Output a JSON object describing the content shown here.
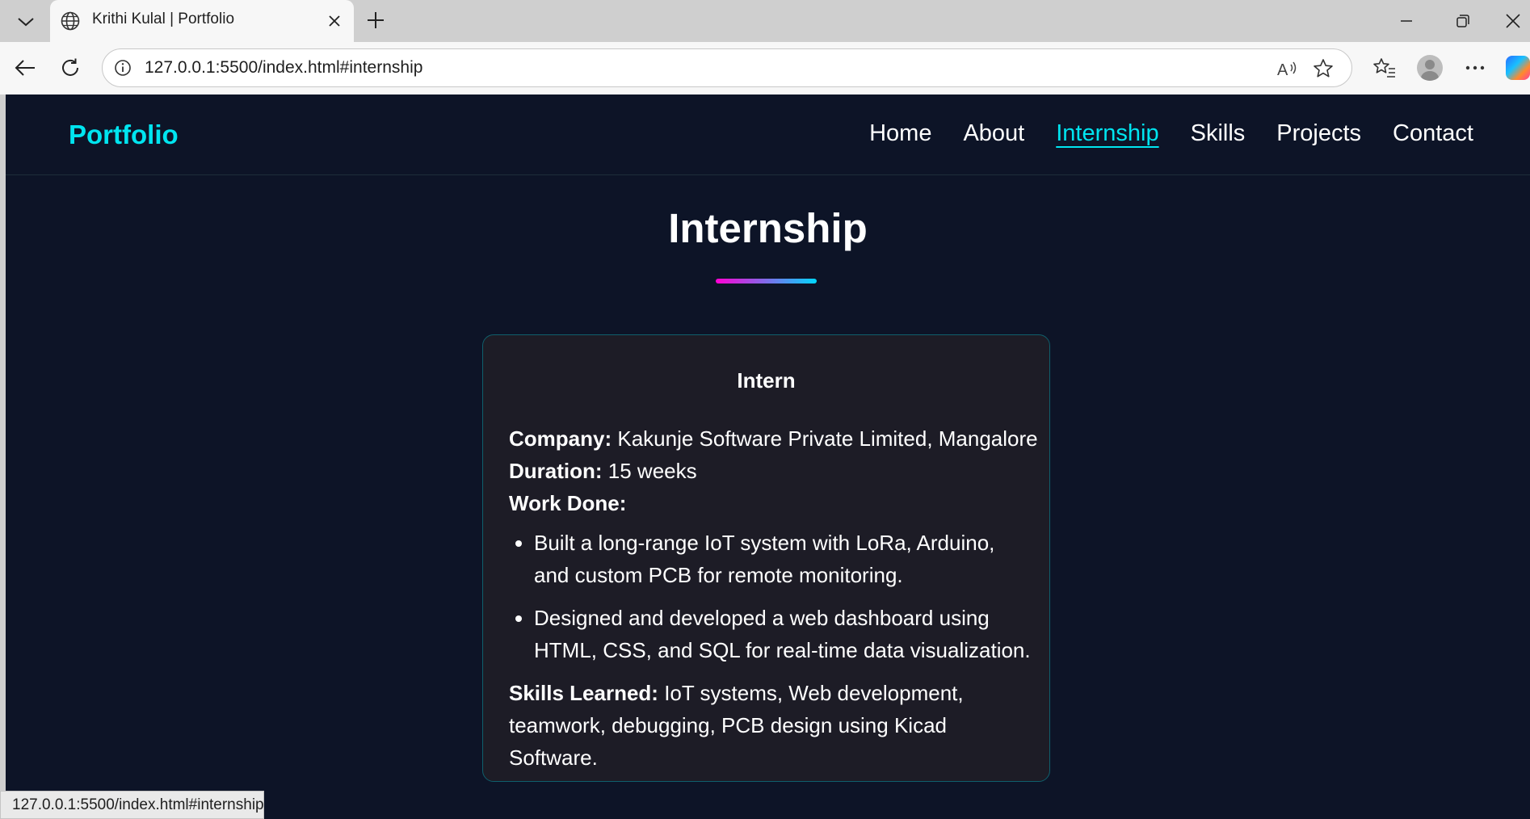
{
  "browser": {
    "tab_title": "Krithi Kulal | Portfolio",
    "url": "127.0.0.1:5500/index.html#internship",
    "status_url": "127.0.0.1:5500/index.html#internship"
  },
  "site": {
    "logo": "Portfolio",
    "nav": [
      "Home",
      "About",
      "Internship",
      "Skills",
      "Projects",
      "Contact"
    ],
    "active_nav": "Internship"
  },
  "section": {
    "title": "Internship",
    "card": {
      "role": "Intern",
      "company_label": "Company:",
      "company_value": " Kakunje Software Private Limited, Mangalore",
      "duration_label": "Duration:",
      "duration_value": " 15 weeks",
      "work_label": "Work Done:",
      "work_items": [
        "Built a long-range IoT system with LoRa, Arduino, and custom PCB for remote monitoring.",
        "Designed and developed a web dashboard using HTML, CSS, and SQL for real-time data visualization."
      ],
      "skills_label": "Skills Learned:",
      "skills_value": " IoT systems, Web development, teamwork, debugging, PCB design using Kicad Software."
    }
  },
  "colors": {
    "accent": "#00e5f0",
    "background": "#0d1427",
    "card_bg": "#1d1c26",
    "card_border": "#0f5f6c",
    "gradient_start": "#ff00d4",
    "gradient_end": "#00d8ff"
  },
  "icons": [
    "tab-list-icon",
    "globe-icon",
    "close-icon",
    "plus-icon",
    "minimize-icon",
    "restore-icon",
    "window-close-icon",
    "back-icon",
    "refresh-icon",
    "info-icon",
    "read-aloud-icon",
    "star-icon",
    "favorites-icon",
    "profile-icon",
    "more-icon",
    "copilot-icon"
  ]
}
